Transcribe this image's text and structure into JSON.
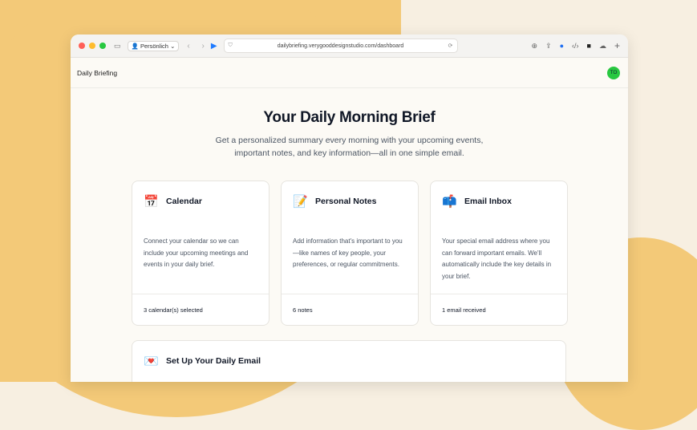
{
  "browser": {
    "profile_label": "Persönlich",
    "url": "dailybriefing.verygooddesignstudio.com/dashboard",
    "colors": {
      "close": "#ff5f57",
      "minimize": "#febc2e",
      "maximize": "#28c840"
    }
  },
  "app": {
    "name": "Daily Briefing",
    "avatar_initials": "TO"
  },
  "hero": {
    "title": "Your Daily Morning Brief",
    "subtitle": "Get a personalized summary every morning with your upcoming events, important notes, and key information—all in one simple email."
  },
  "cards": [
    {
      "icon": "calendar-icon",
      "title": "Calendar",
      "description": "Connect your calendar so we can include your upcoming meetings and events in your daily brief.",
      "status": "3 calendar(s) selected"
    },
    {
      "icon": "notes-icon",
      "title": "Personal Notes",
      "description": "Add information that's important to you—like names of key people, your preferences, or regular commitments.",
      "status": "6 notes"
    },
    {
      "icon": "mailbox-icon",
      "title": "Email Inbox",
      "description": "Your special email address where you can forward important emails. We'll automatically include the key details in your brief.",
      "status": "1 email received"
    }
  ],
  "setup": {
    "icon": "envelope-icon",
    "title": "Set Up Your Daily Email"
  }
}
